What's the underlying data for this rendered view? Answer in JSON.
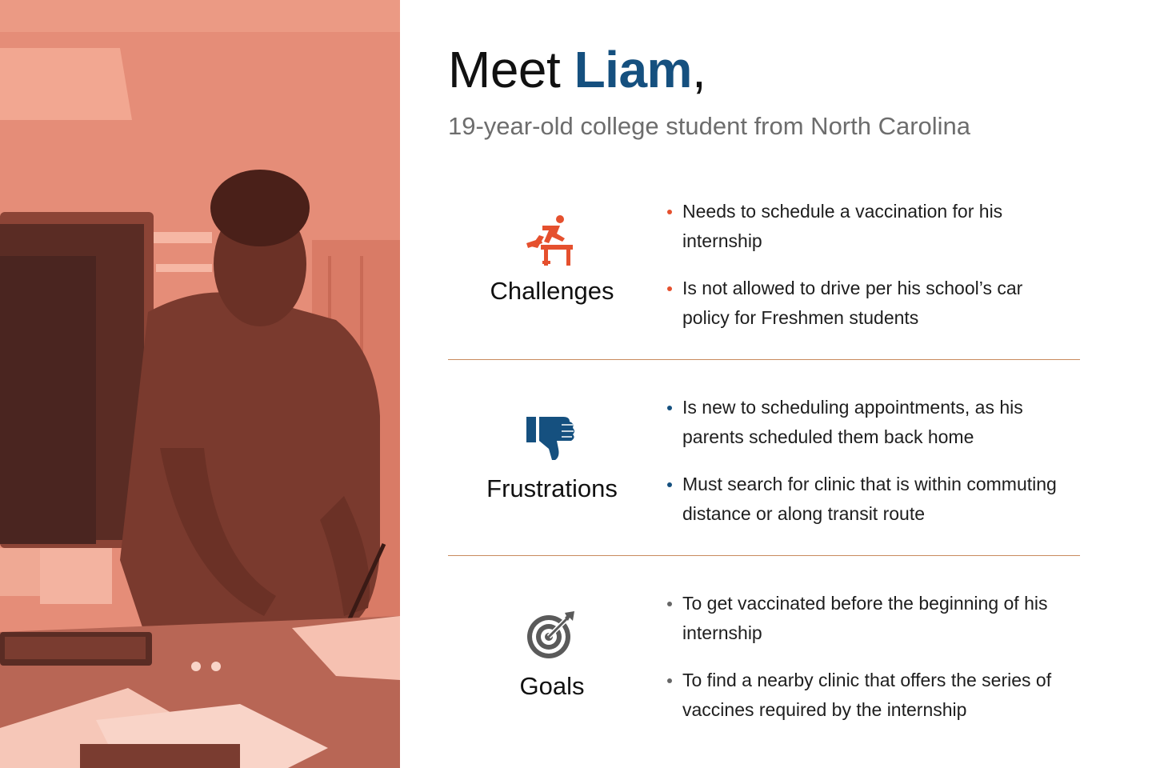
{
  "colors": {
    "accent_blue": "#15507f",
    "accent_orange": "#e5502e",
    "photo_tint": "#e58d78",
    "divider": "#c98a5e",
    "text_gray": "#6d6d6d"
  },
  "header": {
    "prefix": "Meet ",
    "name": "Liam",
    "suffix": ",",
    "subtitle": "19-year-old college student from North Carolina"
  },
  "sections": [
    {
      "label": "Challenges",
      "icon": "hurdle-runner-icon",
      "bullets": [
        "Needs to schedule a vaccination for his internship",
        "Is not allowed to drive per his school’s car policy for Freshmen students"
      ]
    },
    {
      "label": "Frustrations",
      "icon": "thumbs-down-icon",
      "bullets": [
        "Is new to scheduling appointments, as his parents scheduled them back home",
        "Must search for clinic that is within commuting distance or along transit route"
      ]
    },
    {
      "label": "Goals",
      "icon": "target-arrow-icon",
      "bullets": [
        "To get vaccinated before the beginning of his internship",
        "To find a nearby clinic that offers the series of vaccines required by the internship"
      ]
    }
  ]
}
